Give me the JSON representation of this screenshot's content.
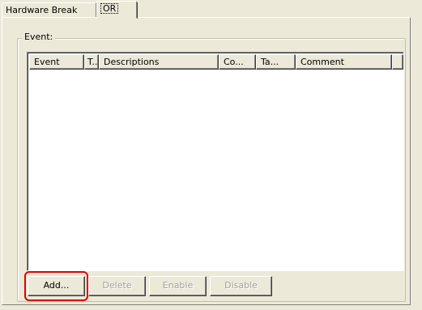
{
  "tabs": [
    {
      "label": "Hardware Break",
      "selected": false
    },
    {
      "label": "OR",
      "selected": true
    }
  ],
  "group": {
    "legend": "Event:"
  },
  "list": {
    "columns": [
      "Event",
      "T...",
      "Descriptions",
      "Co...",
      "Ta...",
      "Comment"
    ],
    "rows": []
  },
  "buttons": {
    "add": "Add...",
    "delete": "Delete",
    "enable": "Enable",
    "disable": "Disable"
  },
  "annotation": {
    "color": "#e00000",
    "target": "add"
  }
}
